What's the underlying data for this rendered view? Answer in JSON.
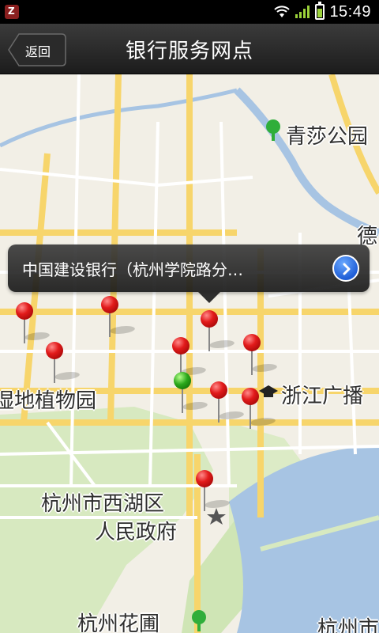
{
  "status_bar": {
    "time": "15:49",
    "icons": [
      "app-notification-icon",
      "wifi-icon",
      "signal-icon",
      "battery-icon"
    ]
  },
  "header": {
    "back_label": "返回",
    "title": "银行服务网点"
  },
  "map": {
    "labels": {
      "qingsha_park": "青莎公园",
      "zhejiang_broadcast": "浙江广播",
      "wetland_garden": "湿地植物园",
      "xihu_gov_line1": "杭州市西湖区",
      "xihu_gov_line2": "人民政府",
      "hangzhou_flower": "杭州花圃",
      "hangzhou_city": "杭州市",
      "de_partial": "德"
    },
    "pin_colors": {
      "default": "#e21b1b",
      "selected": "#2aa81b"
    }
  },
  "callout": {
    "text": "中国建设银行（杭州学院路分…"
  }
}
